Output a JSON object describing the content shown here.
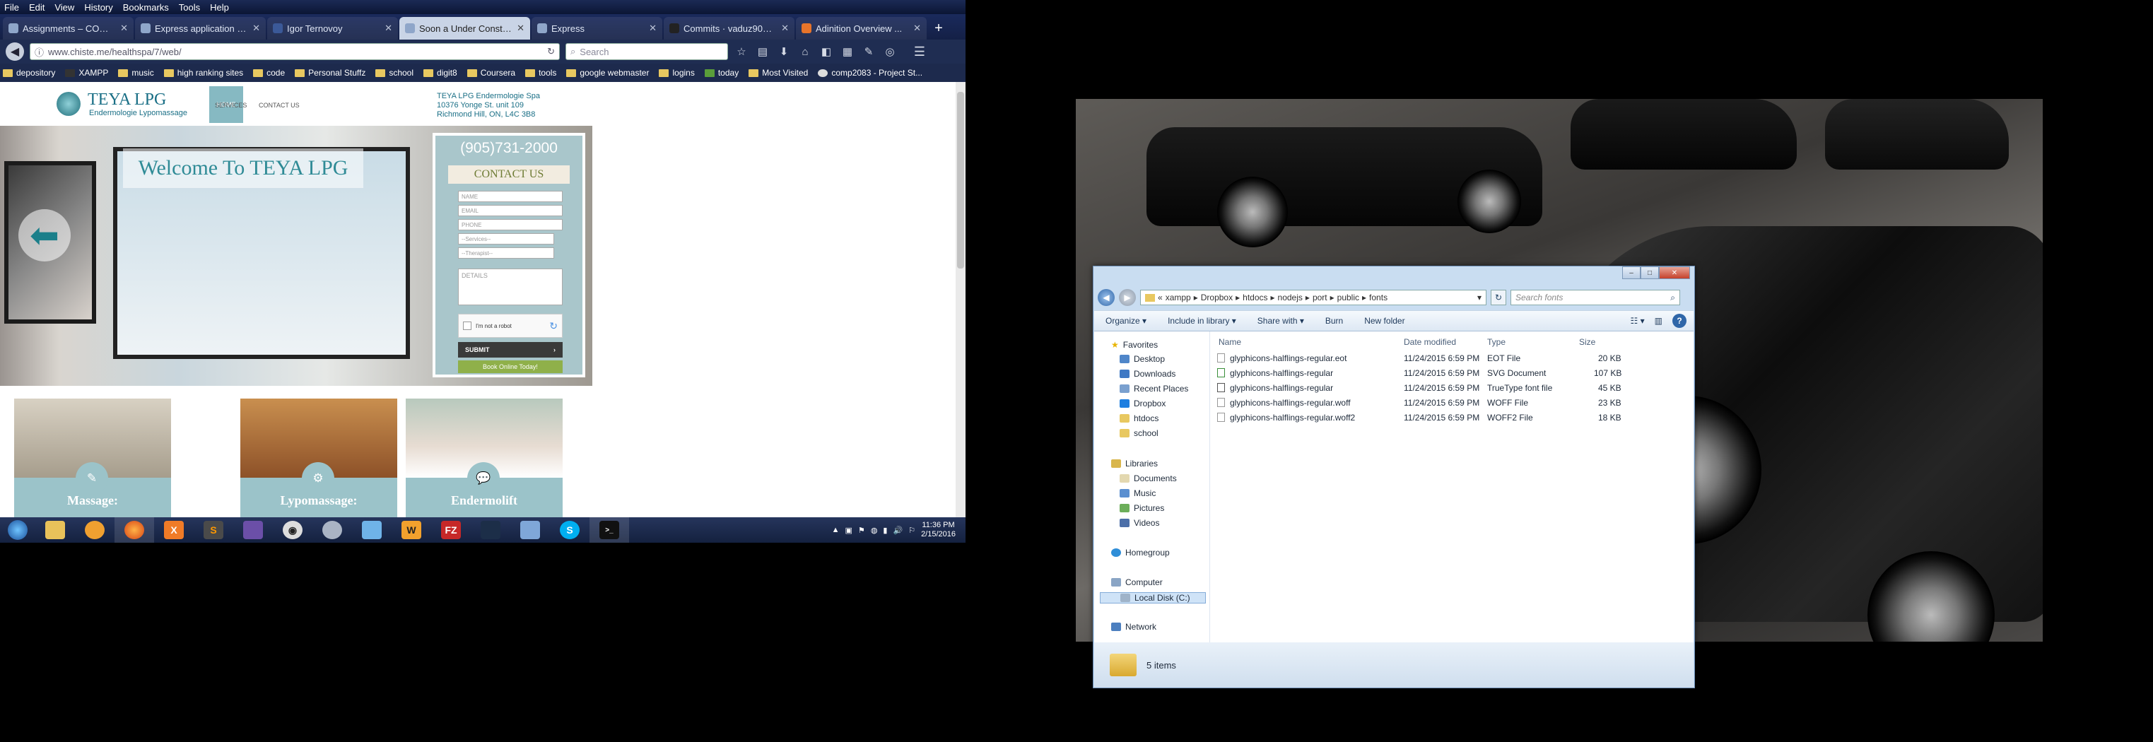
{
  "firefox": {
    "menu": [
      "File",
      "Edit",
      "View",
      "History",
      "Bookmarks",
      "Tools",
      "Help"
    ],
    "tabs": [
      {
        "title": "Assignments – COMP...",
        "active": false
      },
      {
        "title": "Express application genera...",
        "active": false
      },
      {
        "title": "Igor Ternovoy",
        "active": false
      },
      {
        "title": "Soon a Under Constructio...",
        "active": true
      },
      {
        "title": "Express",
        "active": false
      },
      {
        "title": "Commits · vaduz901/...",
        "active": false
      },
      {
        "title": "Adinition Overview ...",
        "active": false
      }
    ],
    "url": "www.chiste.me/healthspa/7/web/",
    "search_placeholder": "Search",
    "bookmarks": [
      "depository",
      "XAMPP",
      "music",
      "high ranking sites",
      "code",
      "Personal Stuffz",
      "school",
      "digit8",
      "Coursera",
      "tools",
      "google webmaster",
      "logins",
      "today",
      "Most Visited",
      "comp2083 - Project St..."
    ]
  },
  "site": {
    "logo_title": "TEYA LPG",
    "logo_sub": "Endermologie  Lypomassage",
    "nav": {
      "home": "HOME",
      "services": "SERVICES",
      "contact": "CONTACT US"
    },
    "address": [
      "TEYA LPG Endermologie Spa",
      "10376 Yonge St. unit 109",
      "Richmond Hill, ON, L4C 3B8"
    ],
    "hero_title": "Welcome To TEYA LPG",
    "phone": "(905)731-2000",
    "contact_title": "CONTACT US",
    "form": {
      "name": "NAME",
      "email": "EMAIL",
      "phone": "PHONE",
      "services": "--Services--",
      "therapist": "--Therapist--",
      "details": "DETAILS",
      "captcha": "I'm not a robot",
      "submit": "SUBMIT",
      "book": "Book Online Today!"
    },
    "services": [
      "Massage:",
      "Lypomassage:",
      "Endermolift"
    ]
  },
  "taskbar": {
    "time": "11:36 PM",
    "date": "2/15/2016"
  },
  "explorer": {
    "breadcrumb": [
      "«",
      "xampp",
      "Dropbox",
      "htdocs",
      "nodejs",
      "port",
      "public",
      "fonts"
    ],
    "search_placeholder": "Search fonts",
    "commands": [
      "Organize ▾",
      "Include in library ▾",
      "Share with ▾",
      "Burn",
      "New folder"
    ],
    "nav": {
      "favorites": "Favorites",
      "favorite_items": [
        "Desktop",
        "Downloads",
        "Recent Places",
        "Dropbox",
        "htdocs",
        "school"
      ],
      "libraries": "Libraries",
      "library_items": [
        "Documents",
        "Music",
        "Pictures",
        "Videos"
      ],
      "homegroup": "Homegroup",
      "computer": "Computer",
      "computer_items": [
        "Local Disk (C:)"
      ],
      "network": "Network"
    },
    "columns": {
      "name": "Name",
      "modified": "Date modified",
      "type": "Type",
      "size": "Size"
    },
    "files": [
      {
        "name": "glyphicons-halflings-regular.eot",
        "modified": "11/24/2015 6:59 PM",
        "type": "EOT File",
        "size": "20 KB"
      },
      {
        "name": "glyphicons-halflings-regular",
        "modified": "11/24/2015 6:59 PM",
        "type": "SVG Document",
        "size": "107 KB"
      },
      {
        "name": "glyphicons-halflings-regular",
        "modified": "11/24/2015 6:59 PM",
        "type": "TrueType font file",
        "size": "45 KB"
      },
      {
        "name": "glyphicons-halflings-regular.woff",
        "modified": "11/24/2015 6:59 PM",
        "type": "WOFF File",
        "size": "23 KB"
      },
      {
        "name": "glyphicons-halflings-regular.woff2",
        "modified": "11/24/2015 6:59 PM",
        "type": "WOFF2 File",
        "size": "18 KB"
      }
    ],
    "status": "5 items"
  }
}
